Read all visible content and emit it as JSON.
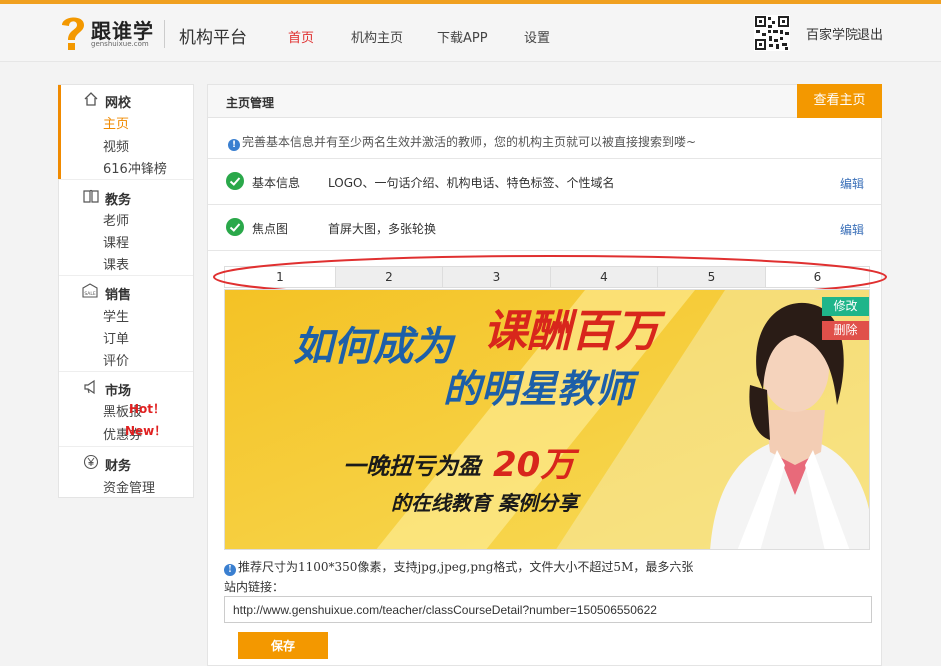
{
  "header": {
    "brand": "跟谁学",
    "domain": "genshuixue.com",
    "platform": "机构平台",
    "nav": [
      "首页",
      "机构主页",
      "下载APP",
      "设置"
    ],
    "active_nav": 0,
    "user": "百家学院",
    "logout": "退出"
  },
  "sidebar": {
    "groups": [
      {
        "title": "网校",
        "icon": "home-icon",
        "items": [
          "主页",
          "视频",
          "616冲锋榜"
        ]
      },
      {
        "title": "教务",
        "icon": "book-icon",
        "items": [
          "老师",
          "课程",
          "课表"
        ]
      },
      {
        "title": "销售",
        "icon": "sale-tag-icon",
        "items": [
          "学生",
          "订单",
          "评价"
        ]
      },
      {
        "title": "市场",
        "icon": "megaphone-icon",
        "items": [
          "黑板报",
          "优惠券"
        ]
      },
      {
        "title": "财务",
        "icon": "yen-icon",
        "items": [
          "资金管理"
        ]
      }
    ],
    "badges": {
      "hot": "Hot！",
      "new": "New！"
    }
  },
  "main": {
    "title": "主页管理",
    "view_button": "查看主页",
    "tip": "完善基本信息并有至少两名生效并激活的教师，您的机构主页就可以被直接搜索到喽~",
    "rows": [
      {
        "label": "基本信息",
        "desc": "LOGO、一句话介绍、机构电话、特色标签、个性域名",
        "edit": "编辑"
      },
      {
        "label": "焦点图",
        "desc": "首屏大图，多张轮换",
        "edit": "编辑"
      }
    ],
    "tabs": [
      "1",
      "2",
      "3",
      "4",
      "5",
      "6"
    ],
    "banner": {
      "line1a": "如何成为",
      "line1b": "课酬百万",
      "line2": "的明星教师",
      "line3a": "一晚扭亏为盈",
      "line3b": "20万",
      "line4": "的在线教育 案例分享",
      "edit": "修改",
      "delete": "删除"
    },
    "recommend": "推荐尺寸为1100*350像素，支持jpg,jpeg,png格式，文件大小不超过5M，最多六张",
    "link_label": "站内链接：",
    "link_value": "http://www.genshuixue.com/teacher/classCourseDetail?number=150506550622",
    "save": "保存"
  },
  "colors": {
    "accent": "#f39800",
    "active_nav": "#e03030",
    "edit_link": "#3a6fb8",
    "check": "#2aa84a",
    "highlight_ellipse": "#e03030"
  }
}
